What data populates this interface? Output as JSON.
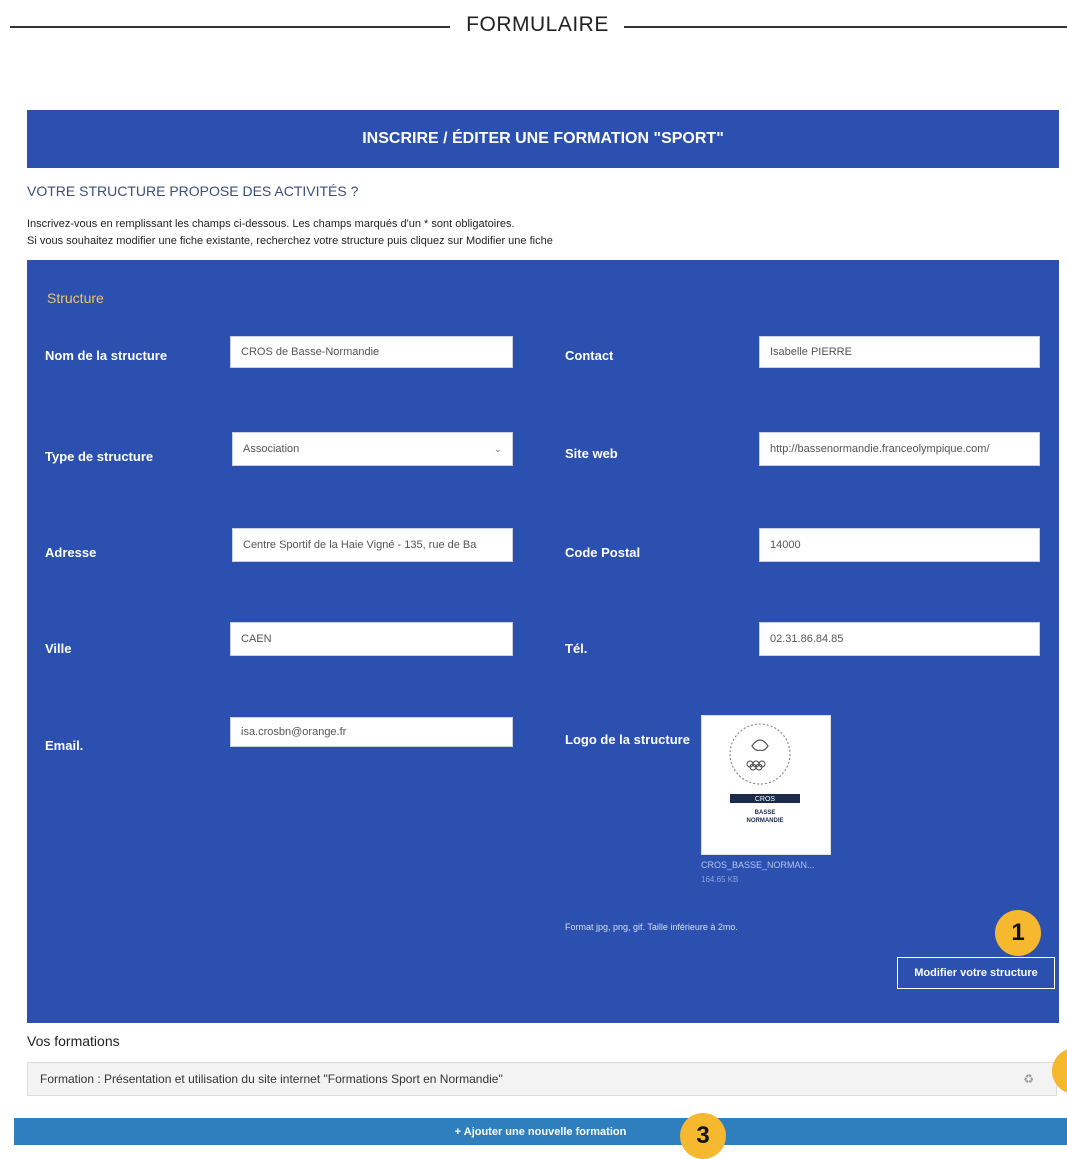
{
  "header": {
    "title": "FORMULAIRE"
  },
  "banner": {
    "title": "INSCRIRE / ÉDITER UNE FORMATION \"SPORT\""
  },
  "intro": {
    "subtitle": "VOTRE STRUCTURE PROPOSE DES ACTIVITÉS ?",
    "line1": "Inscrivez-vous en remplissant les champs ci-dessous. Les champs marqués d'un * sont obligatoires.",
    "line2": "Si vous souhaitez modifier une fiche existante, recherchez votre structure puis cliquez sur Modifier une fiche"
  },
  "form": {
    "section_title": "Structure",
    "fields": {
      "nom": {
        "label": "Nom de la structure",
        "value": "CROS de Basse-Normandie"
      },
      "contact": {
        "label": "Contact",
        "value": "Isabelle PIERRE"
      },
      "type": {
        "label": "Type de structure",
        "value": "Association"
      },
      "site": {
        "label": "Site web",
        "value": "http://bassenormandie.franceolympique.com/"
      },
      "adresse": {
        "label": "Adresse",
        "value": "Centre Sportif de la Haie Vigné - 135, rue de Ba"
      },
      "cp": {
        "label": "Code Postal",
        "value": "14000"
      },
      "ville": {
        "label": "Ville",
        "value": "CAEN"
      },
      "tel": {
        "label": "Tél.",
        "value": "02.31.86.84.85"
      },
      "email": {
        "label": "Email.",
        "value": "isa.crosbn@orange.fr"
      },
      "logo": {
        "label": "Logo de la structure"
      }
    },
    "logo": {
      "org_line": "CROS",
      "region_line1": "BASSE",
      "region_line2": "NORMANDIE",
      "file_name": "CROS_BASSE_NORMAN...",
      "file_size": "164.65 KB"
    },
    "format_note": "Format jpg, png, gif. Taille inférieure à 2mo.",
    "modify_button": "Modifier votre structure"
  },
  "badges": {
    "b1": "1",
    "b3": "3"
  },
  "formations": {
    "title": "Vos formations",
    "items": [
      {
        "label": "Formation : Présentation et utilisation du site internet \"Formations Sport en Normandie\""
      }
    ],
    "add_button": "+ Ajouter une nouvelle formation"
  },
  "colors": {
    "primary": "#2b50b0",
    "accent": "#f5b82e",
    "add_bar": "#2f7fbf"
  },
  "icons": {
    "select": "chevron-down-icon",
    "delete": "trash-icon"
  }
}
